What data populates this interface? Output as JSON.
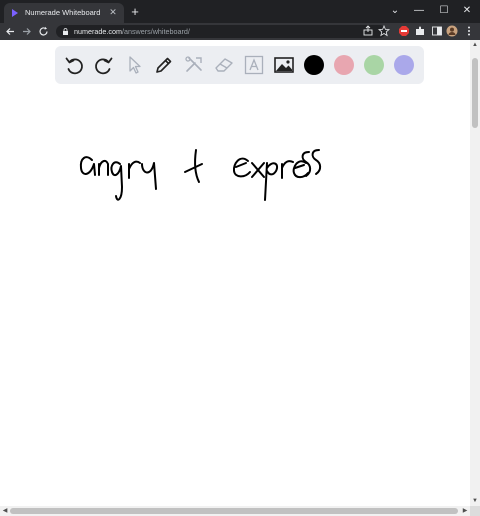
{
  "browser": {
    "tab_title": "Numerade Whiteboard",
    "url_domain": "numerade.com",
    "url_path": "/answers/whiteboard/"
  },
  "whiteboard": {
    "tools": [
      "undo-icon",
      "redo-icon",
      "select-icon",
      "pencil-icon",
      "tools-icon",
      "eraser-icon",
      "text-icon",
      "image-icon"
    ],
    "colors": [
      "#000000",
      "#e8a6b0",
      "#a9d5a5",
      "#aaa8ea"
    ],
    "active_color": "#000000",
    "handwritten_text": "angry + express"
  }
}
